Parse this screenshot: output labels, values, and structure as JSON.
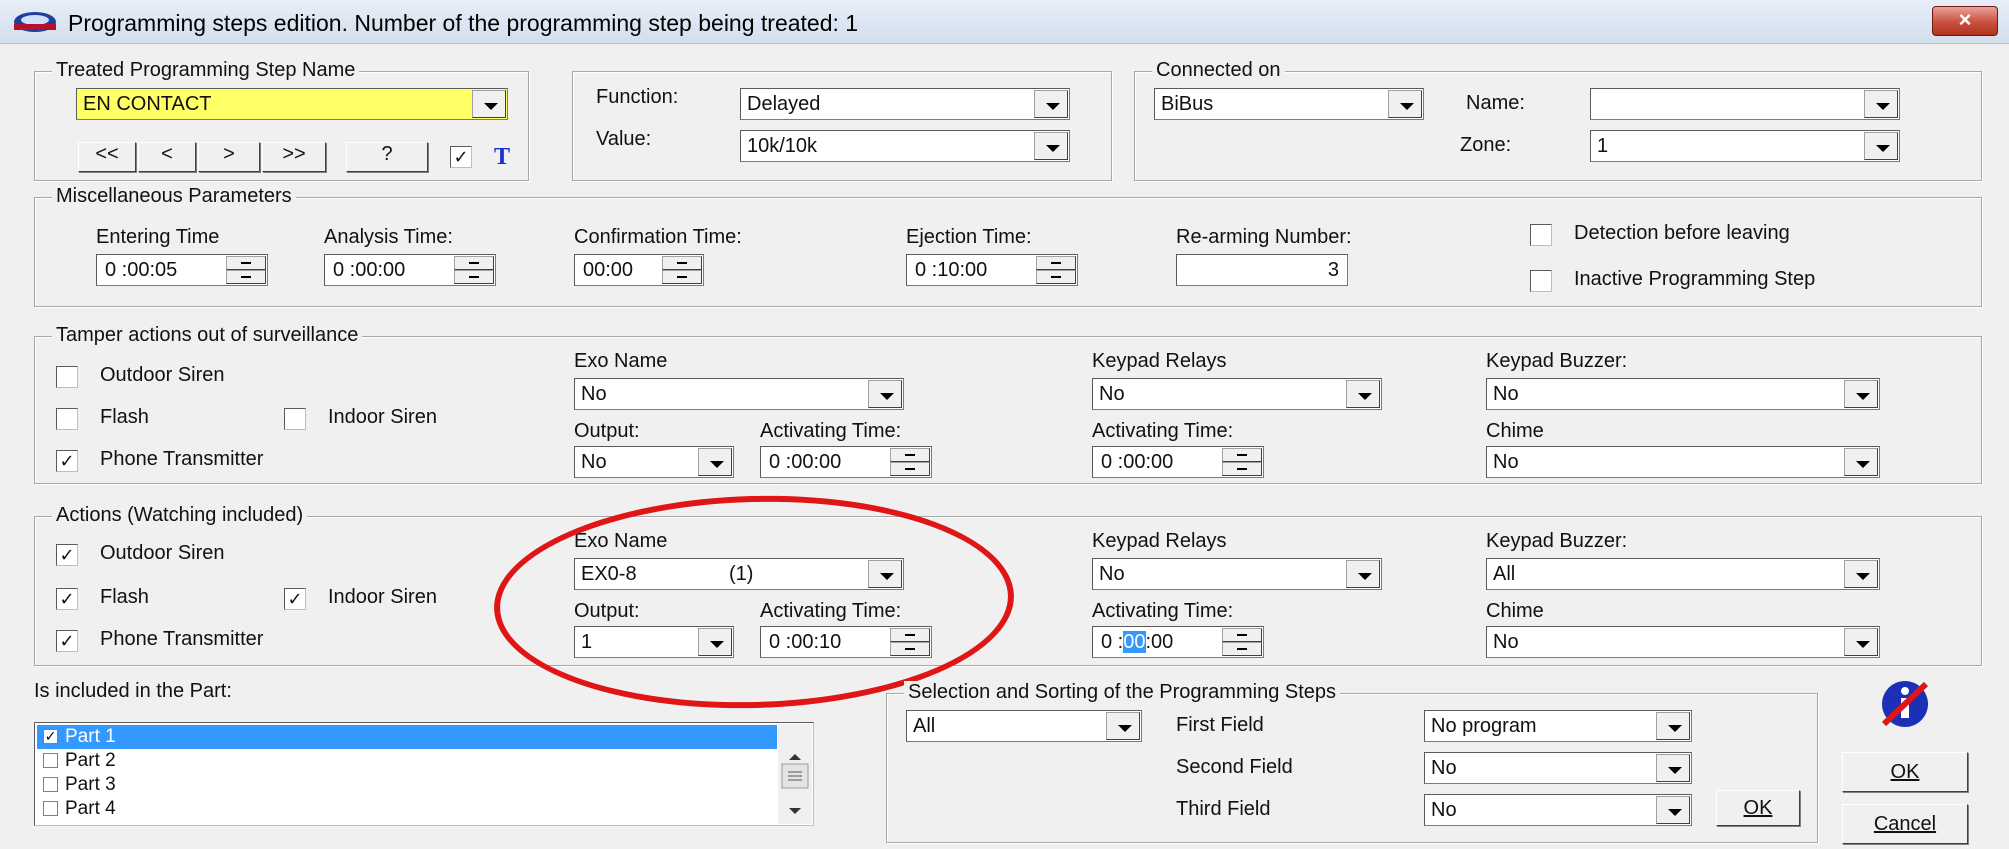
{
  "window": {
    "title": "Programming steps edition.  Number of the programming step being treated: 1",
    "close_glyph": "×"
  },
  "treated_step": {
    "legend": "Treated Programming Step Name",
    "name_value": "EN CONTACT",
    "nav_buttons": [
      "<<",
      "<",
      ">",
      ">>"
    ],
    "help_button": "?",
    "t_checked": true,
    "t_label": "T"
  },
  "function_group": {
    "function_label": "Function:",
    "function_value": "Delayed",
    "value_label": "Value:",
    "value_value": "10k/10k"
  },
  "connected": {
    "legend": "Connected on",
    "bus_value": "BiBus",
    "name_label": "Name:",
    "name_value": "",
    "zone_label": "Zone:",
    "zone_value": "1"
  },
  "misc": {
    "legend": "Miscellaneous Parameters",
    "entering_label": "Entering Time",
    "entering_value": "0 :00:05",
    "analysis_label": "Analysis Time:",
    "analysis_value": "0 :00:00",
    "confirmation_label": "Confirmation Time:",
    "confirmation_value": "00:00",
    "ejection_label": "Ejection Time:",
    "ejection_value": "0 :10:00",
    "rearming_label": "Re-arming Number:",
    "rearming_value": "3",
    "detection_label": "Detection before leaving",
    "detection_checked": false,
    "inactive_label": "Inactive Programming Step",
    "inactive_checked": false
  },
  "tamper": {
    "legend": "Tamper actions out of surveillance",
    "outdoor_siren": "Outdoor Siren",
    "outdoor_checked": false,
    "flash": "Flash",
    "flash_checked": false,
    "indoor_siren": "Indoor Siren",
    "indoor_checked": false,
    "phone": "Phone Transmitter",
    "phone_checked": true,
    "exo_name_label": "Exo Name",
    "exo_name_value": "No",
    "output_label": "Output:",
    "output_value": "No",
    "activating_label": "Activating Time:",
    "activating_value": "0 :00:00",
    "keypad_relays_label": "Keypad Relays",
    "keypad_relays_value": "No",
    "kr_activating_label": "Activating Time:",
    "kr_activating_value": "0 :00:00",
    "buzzer_label": "Keypad Buzzer:",
    "buzzer_value": "No",
    "chime_label": "Chime",
    "chime_value": "No"
  },
  "actions": {
    "legend": "Actions (Watching included)",
    "outdoor_siren": "Outdoor Siren",
    "outdoor_checked": true,
    "flash": "Flash",
    "flash_checked": true,
    "indoor_siren": "Indoor Siren",
    "indoor_checked": true,
    "phone": "Phone Transmitter",
    "phone_checked": true,
    "exo_name_label": "Exo Name",
    "exo_name_value": "EX0-8",
    "exo_name_suffix": "(1)",
    "output_label": "Output:",
    "output_value": "1",
    "activating_label": "Activating Time:",
    "activating_value": "0 :00:10",
    "keypad_relays_label": "Keypad Relays",
    "keypad_relays_value": "No",
    "kr_activating_label": "Activating Time:",
    "kr_activating_prefix": "0 :",
    "kr_activating_selected": "00",
    "kr_activating_suffix": ":00",
    "buzzer_label": "Keypad Buzzer:",
    "buzzer_value": "All",
    "chime_label": "Chime",
    "chime_value": "No"
  },
  "parts": {
    "label": "Is included in the Part:",
    "items": [
      {
        "label": "Part 1",
        "checked": true,
        "selected": true
      },
      {
        "label": "Part 2",
        "checked": false,
        "selected": false
      },
      {
        "label": "Part 3",
        "checked": false,
        "selected": false
      },
      {
        "label": "Part 4",
        "checked": false,
        "selected": false
      }
    ]
  },
  "sorting": {
    "legend": "Selection and Sorting of the Programming Steps",
    "selection_value": "All",
    "first_label": "First Field",
    "first_value": "No program",
    "second_label": "Second Field",
    "second_value": "No",
    "third_label": "Third Field",
    "third_value": "No",
    "ok_label": "OK"
  },
  "dialog_buttons": {
    "ok": "OK",
    "cancel": "Cancel"
  },
  "colors": {
    "highlight": "#3399ff",
    "annotation": "#e01515",
    "name_field": "#ffff66"
  }
}
